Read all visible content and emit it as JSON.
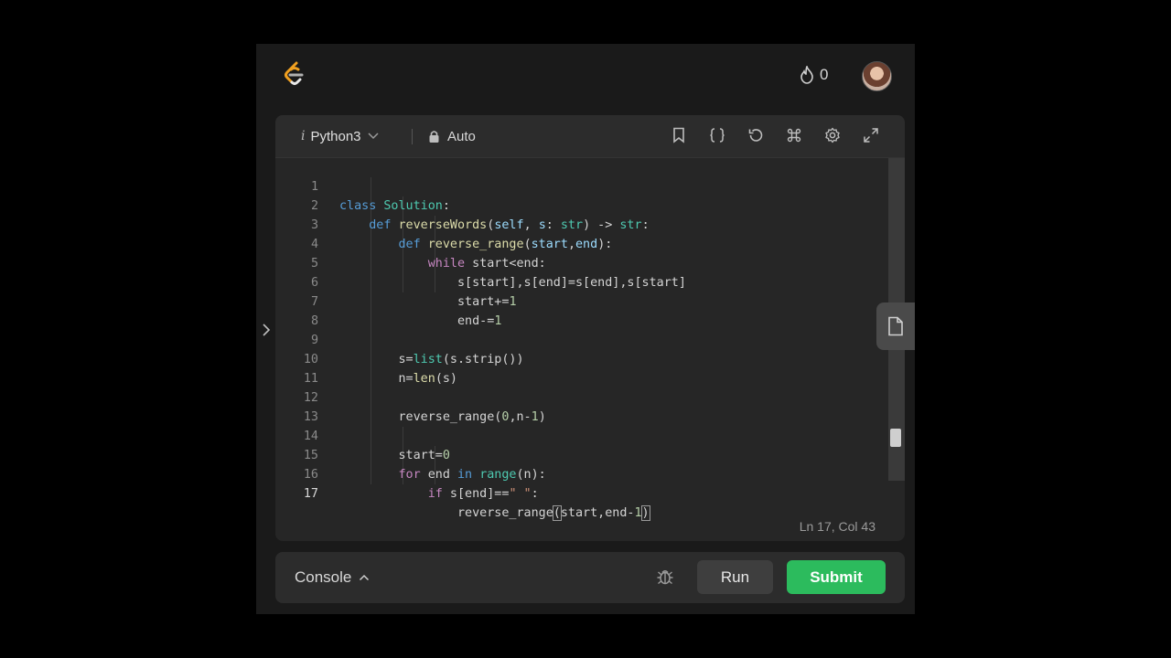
{
  "header": {
    "streak_count": "0",
    "logo_icon": "leetcode-logo",
    "streak_icon": "flame-icon"
  },
  "editor": {
    "language": "Python3",
    "language_prefix": "i",
    "mode": "Auto",
    "toolbar_icons": [
      "bookmark-icon",
      "braces-icon",
      "reset-icon",
      "shortcut-icon",
      "settings-icon",
      "fullscreen-icon"
    ],
    "status": "Ln 17, Col 43",
    "active_line": 17,
    "lines": [
      {
        "n": "1",
        "text": "class Solution:"
      },
      {
        "n": "2",
        "text": "    def reverseWords(self, s: str) -> str:"
      },
      {
        "n": "3",
        "text": "        def reverse_range(start,end):"
      },
      {
        "n": "4",
        "text": "            while start<end:"
      },
      {
        "n": "5",
        "text": "                s[start],s[end]=s[end],s[start]"
      },
      {
        "n": "6",
        "text": "                start+=1"
      },
      {
        "n": "7",
        "text": "                end-=1"
      },
      {
        "n": "8",
        "text": ""
      },
      {
        "n": "9",
        "text": "        s=list(s.strip())"
      },
      {
        "n": "10",
        "text": "        n=len(s)"
      },
      {
        "n": "11",
        "text": ""
      },
      {
        "n": "12",
        "text": "        reverse_range(0,n-1)"
      },
      {
        "n": "13",
        "text": ""
      },
      {
        "n": "14",
        "text": "        start=0"
      },
      {
        "n": "15",
        "text": "        for end in range(n):"
      },
      {
        "n": "16",
        "text": "            if s[end]==\" \":"
      },
      {
        "n": "17",
        "text": "                reverse_range(start,end-1)"
      }
    ]
  },
  "bottom": {
    "console_label": "Console",
    "run_label": "Run",
    "submit_label": "Submit"
  },
  "colors": {
    "submit": "#2cbb5d",
    "keyword": "#569cd6",
    "function": "#dcdcaa",
    "class": "#4ec9b0"
  }
}
